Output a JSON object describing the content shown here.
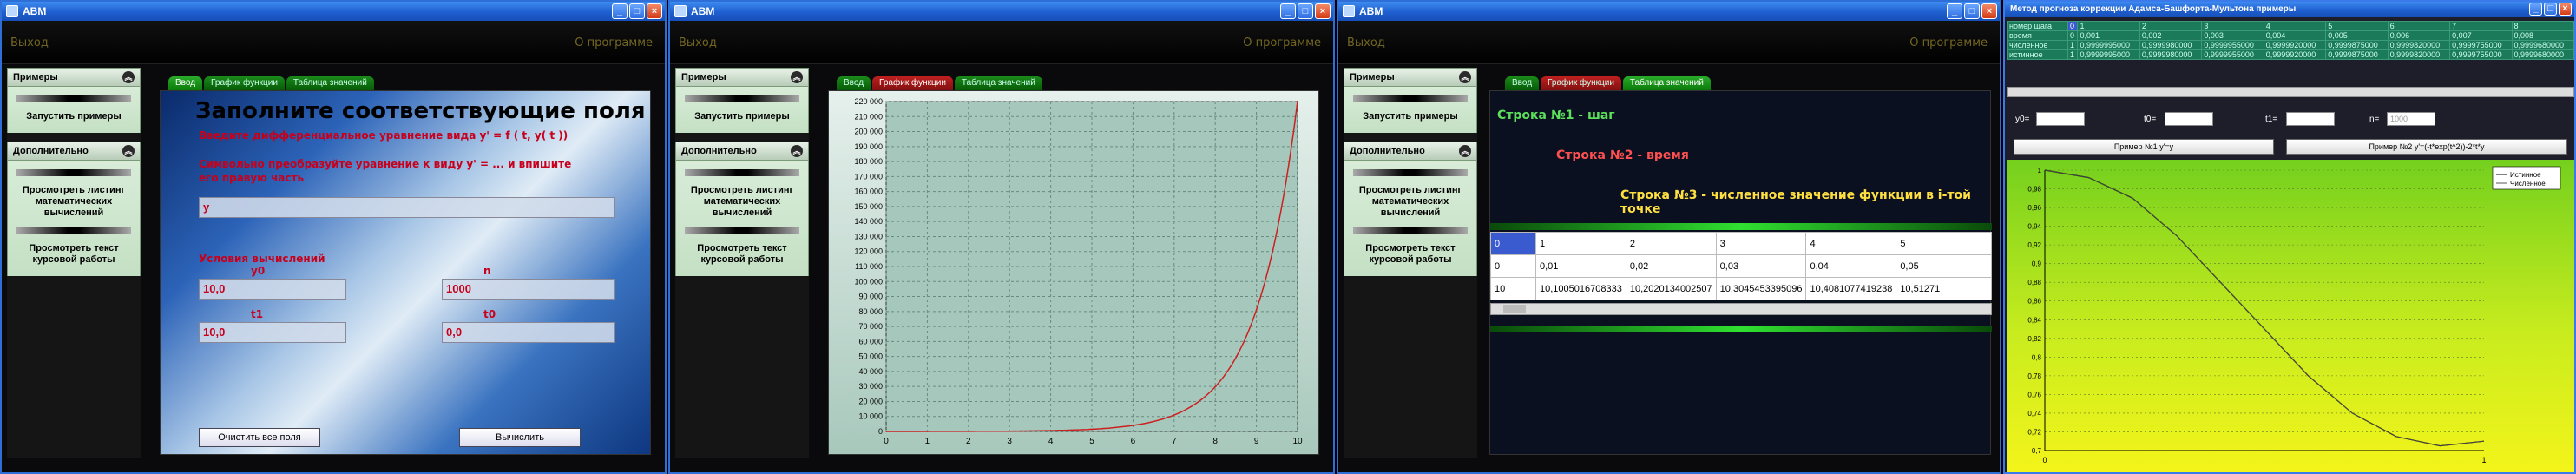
{
  "window1": {
    "title": "АВМ",
    "menu_left": "Выход",
    "menu_right": "О программе",
    "sidebar": {
      "section1": "Примеры",
      "run_examples": "Запустить примеры",
      "section2": "Дополнительно",
      "view_listing": "Просмотреть листинг математических вычислений",
      "view_text": "Просмотреть текст курсовой работы"
    },
    "tabs": [
      "Ввод",
      "График функции",
      "Таблица значений"
    ],
    "form_title": "Заполните соответствующие поля",
    "instruction": "Введите дифференциальное уравнение вида y' = f ( t, y( t ))",
    "hint": "Символьно преобразуйте уравнение к виду y' = ... и впишите его правую часть",
    "equation_value": "y",
    "initial_header": "Условия вычислений",
    "labels": {
      "y0": "y0",
      "n": "n",
      "t1": "t1",
      "t0": "t0"
    },
    "values": {
      "y0": "10,0",
      "n": "1000",
      "t1": "10,0",
      "t0": "0,0"
    },
    "clear_button": "Очистить все поля",
    "calc_button": "Вычислить"
  },
  "window2": {
    "title": "АВМ",
    "menu_left": "Выход",
    "menu_right": "О программе",
    "tabs": [
      "Ввод",
      "График функции",
      "Таблица значений"
    ]
  },
  "window3": {
    "title": "АВМ",
    "menu_left": "Выход",
    "menu_right": "О программе",
    "tabs": [
      "Ввод",
      "График функции",
      "Таблица значений"
    ],
    "line1": "Строка №1 - шаг",
    "line2": "Строка №2 - время",
    "line3": "Строка №3 - численное значение функции в i-той точке",
    "table": [
      [
        "0",
        "1",
        "2",
        "3",
        "4",
        "5"
      ],
      [
        "0",
        "0,01",
        "0,02",
        "0,03",
        "0,04",
        "0,05"
      ],
      [
        "10",
        "10,1005016708333",
        "10,2020134002507",
        "10,3045453395096",
        "10,4081077419238",
        "10,51271"
      ]
    ]
  },
  "window4": {
    "title": "Метод прогноза коррекции Адамса-Башфорта-Мультона примеры",
    "table": [
      [
        "номер шага",
        "0",
        "1",
        "2",
        "3",
        "4",
        "5",
        "6",
        "7",
        "8"
      ],
      [
        "время",
        "0",
        "0,001",
        "0,002",
        "0,003",
        "0,004",
        "0,005",
        "0,006",
        "0,007",
        "0,008"
      ],
      [
        "численное",
        "1",
        "0,9999995000",
        "0,9999980000",
        "0,9999955000",
        "0,9999920000",
        "0,9999875000",
        "0,9999820000",
        "0,9999755000",
        "0,9999680000"
      ],
      [
        "истинное",
        "1",
        "0,9999995000",
        "0,9999980000",
        "0,9999955000",
        "0,9999920000",
        "0,9999875000",
        "0,9999820000",
        "0,9999755000",
        "0,9999680000"
      ]
    ],
    "params": {
      "y0": "y0=",
      "t0": "t0=",
      "t1": "t1=",
      "n": "n=",
      "n_value": "1000"
    },
    "btn1": "Пример №1 y'=y",
    "btn2": "Пример №2 y'=(-t*exp(t^2))-2*t*y",
    "legend": [
      "Истинное",
      "Численное"
    ]
  },
  "chart_main": {
    "type": "line",
    "ylim": [
      0,
      220000
    ],
    "xlim": [
      0,
      10
    ],
    "yticks": [
      0,
      10000,
      20000,
      30000,
      40000,
      50000,
      60000,
      70000,
      80000,
      90000,
      100000,
      110000,
      120000,
      130000,
      140000,
      150000,
      160000,
      170000,
      180000,
      190000,
      200000,
      210000,
      220000
    ],
    "ytick_labels": [
      "0",
      "10 000",
      "20 000",
      "30 000",
      "40 000",
      "50 000",
      "60 000",
      "70 000",
      "80 000",
      "90 000",
      "100 000",
      "110 000",
      "120 000",
      "130 000",
      "140 000",
      "150 000",
      "160 000",
      "170 000",
      "180 000",
      "190 000",
      "200 000",
      "210 000",
      "220 000"
    ],
    "xticks": [
      0,
      1,
      2,
      3,
      4,
      5,
      6,
      7,
      8,
      9,
      10
    ],
    "series_color": "#cc2020",
    "x": [
      0,
      1,
      2,
      3,
      4,
      5,
      6,
      7,
      8,
      9,
      10
    ],
    "y": [
      10,
      27,
      74,
      201,
      546,
      1484,
      4034,
      10966,
      29810,
      81031,
      220265
    ]
  },
  "chart_data": {
    "type": "line",
    "xlim": [
      0,
      1
    ],
    "ylim": [
      0.7,
      1
    ],
    "yticks": [
      0.7,
      0.72,
      0.74,
      0.76,
      0.78,
      0.8,
      0.82,
      0.84,
      0.86,
      0.88,
      0.9,
      0.92,
      0.94,
      0.96,
      0.98,
      1
    ],
    "ytick_labels": [
      "0,7",
      "0,72",
      "0,74",
      "0,76",
      "0,78",
      "0,8",
      "0,82",
      "0,84",
      "0,86",
      "0,88",
      "0,9",
      "0,92",
      "0,94",
      "0,96",
      "0,98",
      "1"
    ],
    "xticks": [
      0,
      1
    ],
    "xtick_labels": [
      "0",
      "1"
    ],
    "series": [
      {
        "name": "Истинное",
        "color": "#000000",
        "x": [
          0,
          0.1,
          0.2,
          0.3,
          0.4,
          0.5,
          0.6,
          0.7,
          0.8,
          0.9,
          1
        ],
        "y": [
          1,
          0.992,
          0.97,
          0.93,
          0.88,
          0.83,
          0.78,
          0.74,
          0.715,
          0.705,
          0.71
        ]
      },
      {
        "name": "Численное",
        "color": "#555555",
        "x": [
          0,
          0.1,
          0.2,
          0.3,
          0.4,
          0.5,
          0.6,
          0.7,
          0.8,
          0.9,
          1
        ],
        "y": [
          1,
          0.992,
          0.97,
          0.93,
          0.88,
          0.83,
          0.78,
          0.74,
          0.715,
          0.705,
          0.71
        ]
      }
    ]
  },
  "colors": {
    "accent": "#2d6fd6",
    "tab_green": "#0a7a0a",
    "red_text": "#c8001c",
    "chart_red": "#cc2020"
  }
}
